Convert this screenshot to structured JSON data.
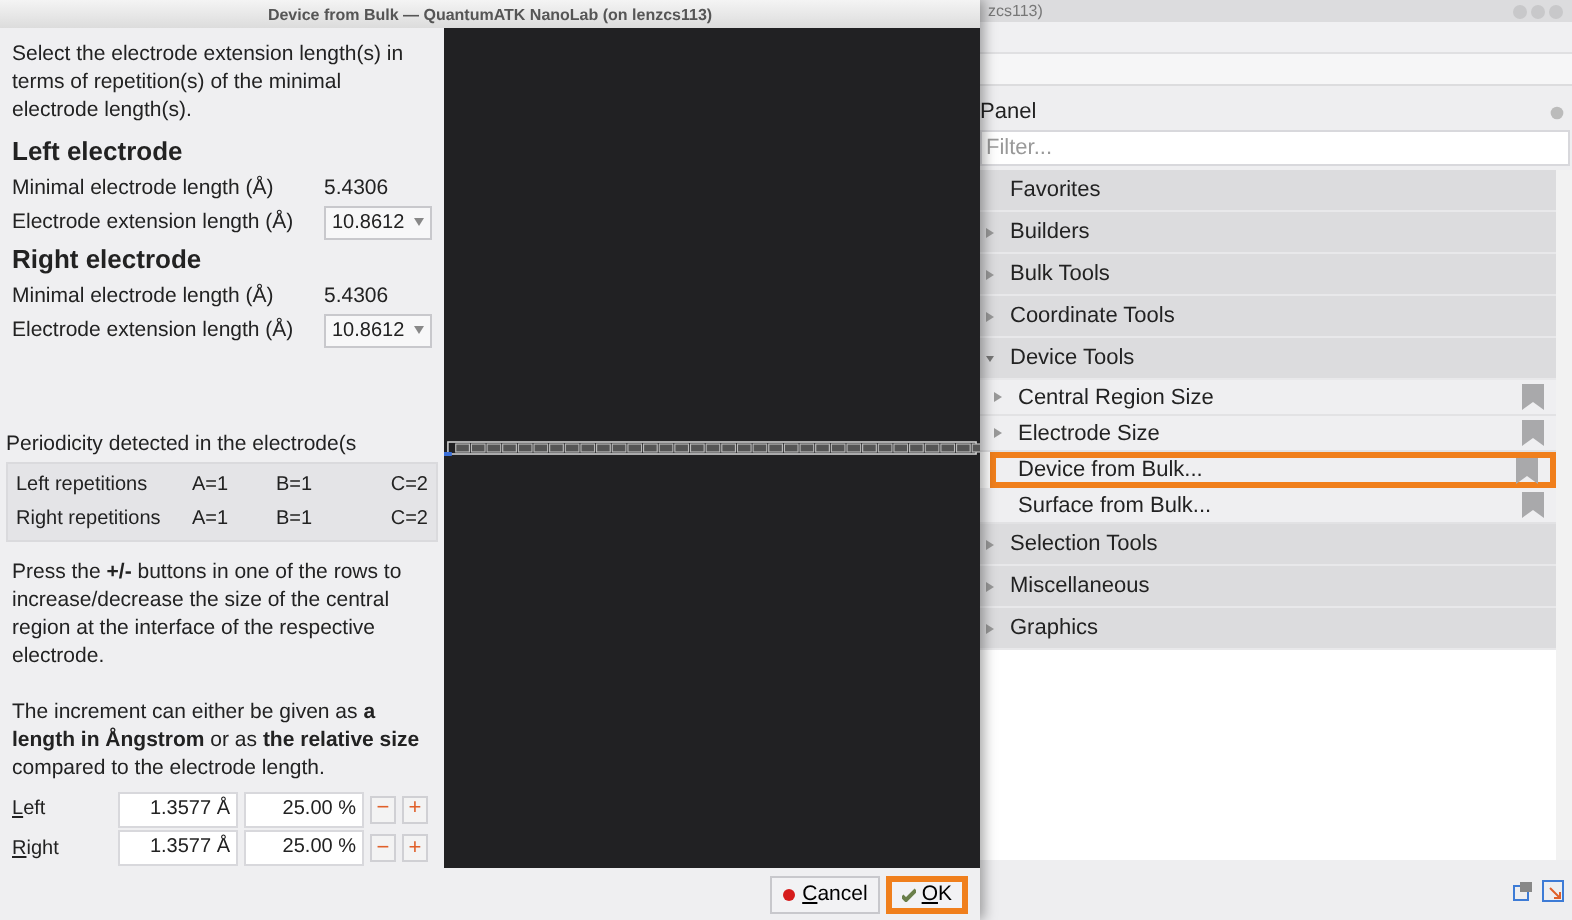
{
  "dialog": {
    "title": "Device from Bulk — QuantumATK NanoLab (on lenzcs113)",
    "intro": "Select the electrode extension length(s) in terms of repetition(s) of the minimal electrode length(s).",
    "electrodes": [
      {
        "heading": "Left electrode",
        "minimal_label": "Minimal electrode length (Å)",
        "minimal_value": "5.4306",
        "extension_label": "Electrode extension length (Å)",
        "extension_value": "10.8612"
      },
      {
        "heading": "Right electrode",
        "minimal_label": "Minimal electrode length (Å)",
        "minimal_value": "5.4306",
        "extension_label": "Electrode extension length (Å)",
        "extension_value": "10.8612"
      }
    ],
    "periodicity_title": "Periodicity detected in the electrode(s",
    "repetitions": [
      {
        "label": "Left repetitions",
        "a": "A=1",
        "b": "B=1",
        "c": "C=2"
      },
      {
        "label": "Right repetitions",
        "a": "A=1",
        "b": "B=1",
        "c": "C=2"
      }
    ],
    "help_1": "Press the **+/-** buttons in one of the rows to increase/decrease the size of the central region at the interface of the respective electrode.",
    "help_2": "The increment can either be given as **a length in Ångstrom** or as **the relative size** compared to the electrode length.",
    "increments": [
      {
        "label": "Left",
        "length": "1.3577 Å",
        "percent": "25.00 %",
        "minus": "−",
        "plus": "+"
      },
      {
        "label": "Right",
        "length": "1.3577 Å",
        "percent": "25.00 %",
        "minus": "−",
        "plus": "+"
      }
    ],
    "buttons": [
      {
        "label": "Cancel",
        "kind": "cancel",
        "highlighted": false
      },
      {
        "label": "OK",
        "kind": "ok",
        "highlighted": true
      }
    ]
  },
  "main_window": {
    "title_fragment": "zcs113)",
    "panel": {
      "title": "Panel",
      "filter_placeholder": "Filter...",
      "items": [
        {
          "label": "Favorites",
          "expandable": false
        },
        {
          "label": "Builders",
          "expandable": true,
          "expanded": false
        },
        {
          "label": "Bulk Tools",
          "expandable": true,
          "expanded": false
        },
        {
          "label": "Coordinate Tools",
          "expandable": true,
          "expanded": false
        },
        {
          "label": "Device Tools",
          "expandable": true,
          "expanded": true,
          "children": [
            {
              "label": "Central Region Size",
              "expandable": true,
              "highlighted": false
            },
            {
              "label": "Electrode Size",
              "expandable": true,
              "highlighted": false
            },
            {
              "label": "Device from Bulk...",
              "expandable": false,
              "highlighted": true
            },
            {
              "label": "Surface from Bulk...",
              "expandable": false,
              "highlighted": false
            }
          ]
        },
        {
          "label": "Selection Tools",
          "expandable": true,
          "expanded": false
        },
        {
          "label": "Miscellaneous",
          "expandable": true,
          "expanded": false
        },
        {
          "label": "Graphics",
          "expandable": true,
          "expanded": false
        }
      ]
    }
  }
}
